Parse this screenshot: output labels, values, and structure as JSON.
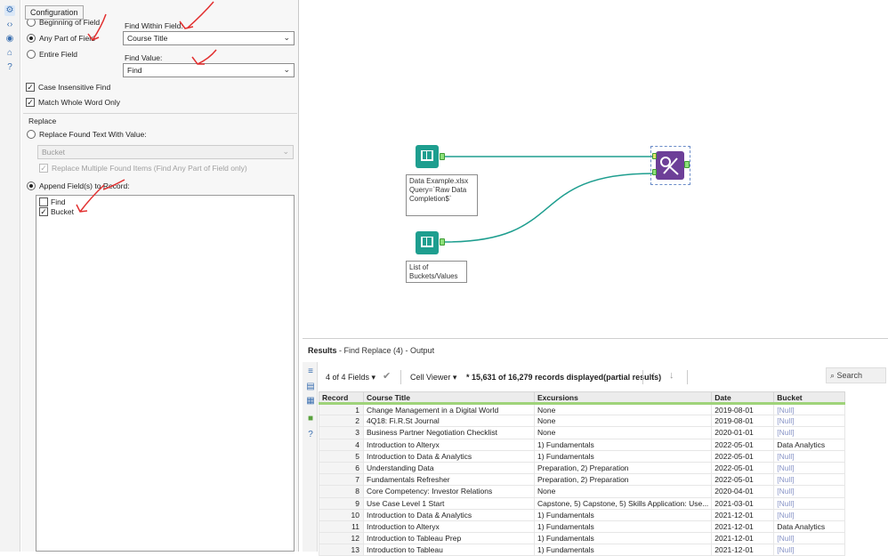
{
  "config": {
    "tooltip": "Configuration",
    "find_mode": {
      "options": [
        "Beginning of Field",
        "Any Part of Field",
        "Entire Field"
      ],
      "selected": "Any Part of Field"
    },
    "find_within_field": {
      "label": "Find Within Field:",
      "value": "Course Title"
    },
    "find_value": {
      "label": "Find Value:",
      "value": "Find"
    },
    "case_insensitive": {
      "label": "Case Insensitive Find",
      "checked": true
    },
    "match_whole_word": {
      "label": "Match Whole Word Only",
      "checked": true
    },
    "replace": {
      "section_label": "Replace",
      "replace_found_text": {
        "label": "Replace Found Text With Value:",
        "selected": false
      },
      "replace_value": "Bucket",
      "replace_multiple": {
        "label": "Replace Multiple Found Items (Find Any Part of Field only)",
        "checked": true,
        "disabled": true
      },
      "append_fields": {
        "label": "Append Field(s) to Record:",
        "selected": true
      },
      "fields": [
        {
          "label": "Find",
          "checked": false
        },
        {
          "label": "Bucket",
          "checked": true
        }
      ]
    }
  },
  "canvas": {
    "input1_annotation": [
      "Data Example.xlsx",
      "Query=`Raw Data",
      "Completion$`"
    ],
    "input2_annotation": [
      "List of",
      "Buckets/Values"
    ],
    "find_replace_tool": "find-replace",
    "colors": {
      "input_tool": "#1e9e8f",
      "find_replace_tool": "#6d3f98",
      "connection": "#1e9e8f",
      "anchor": "#8de07a"
    }
  },
  "results": {
    "title_prefix": "Results",
    "title_suffix": "- Find Replace (4) - Output",
    "fields_count": "4 of 4 Fields",
    "cell_viewer": "Cell Viewer",
    "records_info": "* 15,631 of 16,279 records displayed(partial results)",
    "search_label": "Search",
    "columns": [
      "Record",
      "Course Title",
      "Excursions",
      "Date",
      "Bucket"
    ],
    "rows": [
      [
        "1",
        "Change Management in a Digital World",
        "None",
        "2019-08-01",
        "[Null]"
      ],
      [
        "2",
        "4Q18: Fi.R.St Journal",
        "None",
        "2019-08-01",
        "[Null]"
      ],
      [
        "3",
        "Business Partner Negotiation Checklist",
        "None",
        "2020-01-01",
        "[Null]"
      ],
      [
        "4",
        "Introduction to Alteryx",
        "1) Fundamentals",
        "2022-05-01",
        "Data Analytics"
      ],
      [
        "5",
        "Introduction to Data & Analytics",
        "1) Fundamentals",
        "2022-05-01",
        "[Null]"
      ],
      [
        "6",
        "Understanding Data",
        "Preparation, 2) Preparation",
        "2022-05-01",
        "[Null]"
      ],
      [
        "7",
        "Fundamentals Refresher",
        "Preparation, 2) Preparation",
        "2022-05-01",
        "[Null]"
      ],
      [
        "8",
        "Core Competency: Investor Relations",
        "None",
        "2020-04-01",
        "[Null]"
      ],
      [
        "9",
        "Use Case Level 1 Start",
        "Capstone, 5) Capstone, 5) Skills Application: Use...",
        "2021-03-01",
        "[Null]"
      ],
      [
        "10",
        "Introduction to Data & Analytics",
        "1) Fundamentals",
        "2021-12-01",
        "[Null]"
      ],
      [
        "11",
        "Introduction to Alteryx",
        "1) Fundamentals",
        "2021-12-01",
        "Data Analytics"
      ],
      [
        "12",
        "Introduction to Tableau Prep",
        "1) Fundamentals",
        "2021-12-01",
        "[Null]"
      ],
      [
        "13",
        "Introduction to Tableau",
        "1) Fundamentals",
        "2021-12-01",
        "[Null]"
      ]
    ]
  }
}
